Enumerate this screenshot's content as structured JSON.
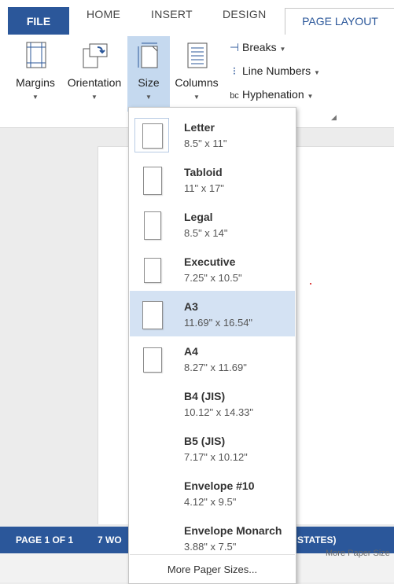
{
  "tabs": {
    "file": "FILE",
    "home": "HOME",
    "insert": "INSERT",
    "design": "DESIGN",
    "page_layout": "PAGE LAYOUT"
  },
  "ribbon": {
    "margins": "Margins",
    "orientation": "Orientation",
    "size": "Size",
    "columns": "Columns",
    "breaks": "Breaks",
    "line_numbers": "Line Numbers",
    "hyphenation": "Hyphenation"
  },
  "size_menu": {
    "items": [
      {
        "name": "Letter",
        "dims": "8.5\" x 11\""
      },
      {
        "name": "Tabloid",
        "dims": "11\" x 17\""
      },
      {
        "name": "Legal",
        "dims": "8.5\" x 14\""
      },
      {
        "name": "Executive",
        "dims": "7.25\" x 10.5\""
      },
      {
        "name": "A3",
        "dims": "11.69\" x 16.54\""
      },
      {
        "name": "A4",
        "dims": "8.27\" x 11.69\""
      },
      {
        "name": "B4 (JIS)",
        "dims": "10.12\" x 14.33\""
      },
      {
        "name": "B5 (JIS)",
        "dims": "7.17\" x 10.12\""
      },
      {
        "name": "Envelope #10",
        "dims": "4.12\" x 9.5\""
      },
      {
        "name": "Envelope Monarch",
        "dims": "3.88\" x 7.5\""
      }
    ],
    "selected": "Letter",
    "highlighted": "A3",
    "more_prefix": "More Pa",
    "more_underline": "p",
    "more_suffix": "er Sizes..."
  },
  "status": {
    "page": "PAGE 1 OF 1",
    "words": "7 WO",
    "language_tail": "STATES)"
  },
  "bottom_text": "More Paper Size",
  "colors": {
    "accent": "#2b579a",
    "highlight": "#c5d9ef"
  }
}
